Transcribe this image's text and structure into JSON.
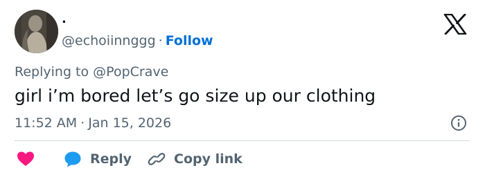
{
  "user": {
    "display_name": ".",
    "handle": "@echoiinnggg",
    "separator": "·",
    "follow_label": "Follow"
  },
  "reply_context": {
    "prefix": "Replying to",
    "mention": "@PopCrave"
  },
  "tweet": {
    "text": "girl i’m bored let’s go size up our clothing",
    "time": "11:52 AM",
    "separator": "·",
    "date": "Jan 15, 2026"
  },
  "actions": {
    "reply_label": "Reply",
    "copy_link_label": "Copy link"
  },
  "icons": {
    "brand": "x-logo-icon",
    "info": "info-icon",
    "like": "heart-icon",
    "reply": "speech-bubble-icon",
    "copy": "link-icon"
  },
  "colors": {
    "text": "#0f1419",
    "secondary": "#536471",
    "link": "#006fd6",
    "like": "#f91880",
    "reply": "#1d9bf0",
    "divider": "#cfd9de"
  }
}
